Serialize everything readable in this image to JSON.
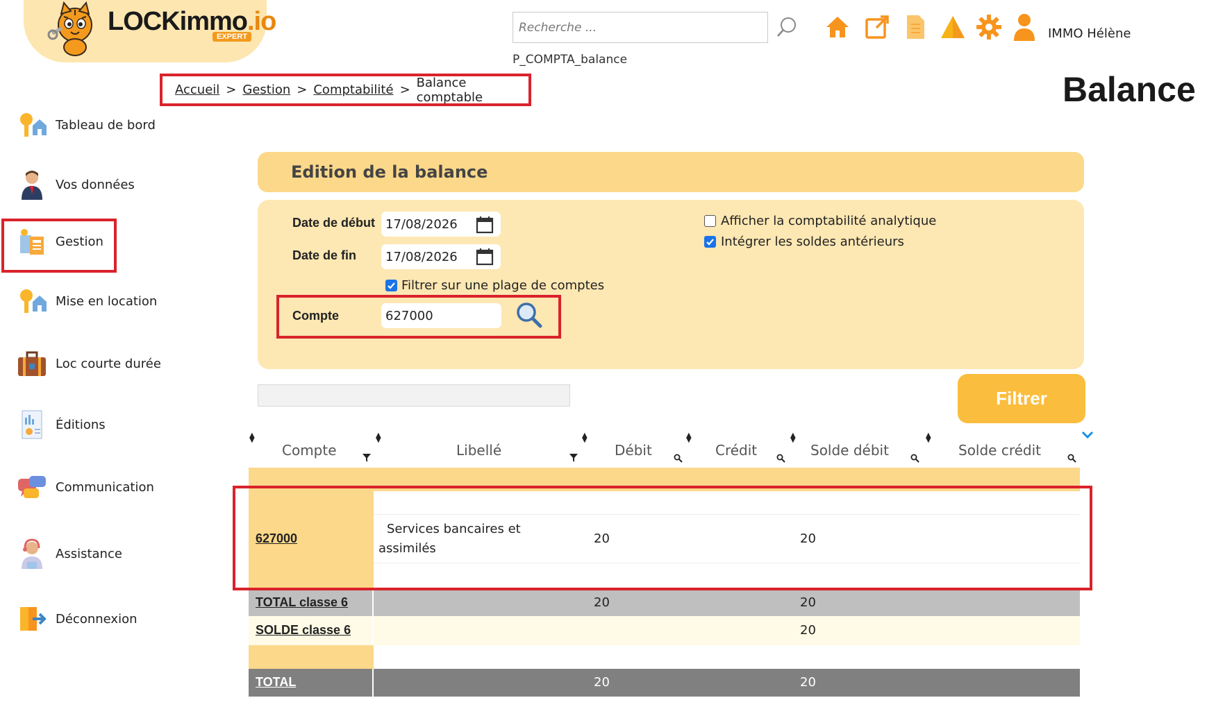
{
  "brand": {
    "name_main": "LOCKimmo",
    "name_suffix": ".io",
    "badge": "EXPERT"
  },
  "header": {
    "search_placeholder": "Recherche ...",
    "page_code": "P_COMPTA_balance",
    "user_name": "IMMO Hélène",
    "icons": [
      "search-icon",
      "home-icon",
      "external-link-icon",
      "document-icon",
      "warning-icon",
      "gear-icon",
      "user-icon"
    ]
  },
  "breadcrumb": {
    "items": [
      "Accueil",
      "Gestion",
      "Comptabilité"
    ],
    "current": "Balance comptable",
    "separator": ">"
  },
  "page_title": "Balance",
  "sidebar": {
    "items": [
      {
        "label": "Tableau de bord",
        "icon": "keys-house-icon"
      },
      {
        "label": "Vos données",
        "icon": "person-icon"
      },
      {
        "label": "Gestion",
        "icon": "management-icon",
        "active": true
      },
      {
        "label": "Mise en location",
        "icon": "keys-house-icon"
      },
      {
        "label": "Loc courte durée",
        "icon": "suitcase-icon"
      },
      {
        "label": "Éditions",
        "icon": "report-icon"
      },
      {
        "label": "Communication",
        "icon": "chat-bubbles-icon"
      },
      {
        "label": "Assistance",
        "icon": "support-agent-icon"
      },
      {
        "label": "Déconnexion",
        "icon": "logout-icon"
      }
    ]
  },
  "form": {
    "section_title": "Edition de la balance",
    "date_start_label": "Date de début",
    "date_start_value": "17/08/2026",
    "date_end_label": "Date de fin",
    "date_end_value": "17/08/2026",
    "filter_range_label": "Filtrer sur une plage de comptes",
    "filter_range_checked": true,
    "account_label": "Compte",
    "account_value": "627000",
    "analytic_label": "Afficher la comptabilité analytique",
    "analytic_checked": false,
    "prior_balances_label": "Intégrer les soldes antérieurs",
    "prior_balances_checked": true,
    "filter_button": "Filtrer"
  },
  "table": {
    "columns": [
      "Compte",
      "Libellé",
      "Débit",
      "Crédit",
      "Solde débit",
      "Solde crédit"
    ],
    "rows": [
      {
        "compte": "627000",
        "libelle_line1": "Services bancaires et",
        "libelle_line2": "assimilés",
        "debit": "20",
        "credit": "",
        "solde_debit": "20",
        "solde_credit": ""
      }
    ],
    "total_classe": {
      "label": "TOTAL classe 6",
      "debit": "20",
      "solde_debit": "20"
    },
    "solde_classe": {
      "label": "SOLDE classe 6",
      "solde_debit": "20"
    },
    "total": {
      "label": "TOTAL",
      "debit": "20",
      "solde_debit": "20"
    }
  },
  "colors": {
    "accent_orange": "#fbbd3d",
    "panel_bg": "#fde7b3",
    "header_bg": "#fcd88a",
    "annotation_red": "#d9232b",
    "total_gray": "#bfbfbf",
    "grand_total_gray": "#808080",
    "solde_cream": "#fffbe6"
  }
}
